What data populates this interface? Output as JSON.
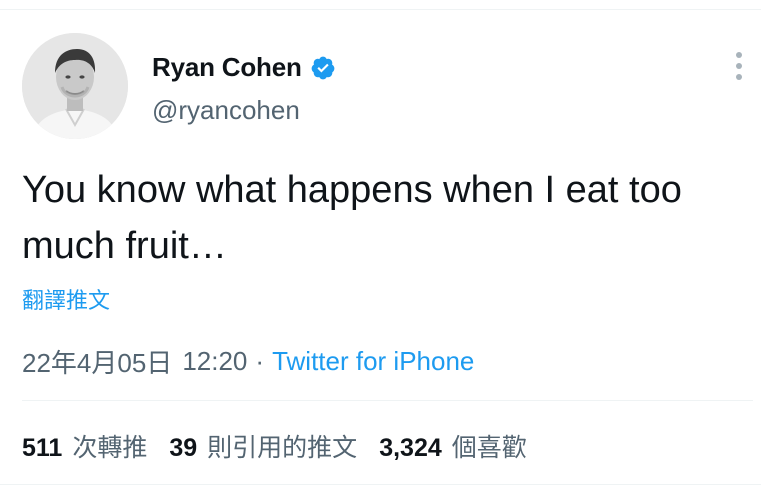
{
  "author": {
    "display_name": "Ryan Cohen",
    "handle": "@ryancohen",
    "verified": true
  },
  "tweet": {
    "text": "You know what happens when I eat too much fruit…",
    "translate_label": "翻譯推文",
    "date": "22年4月05日",
    "time": "12:20",
    "separator": "·",
    "source": "Twitter for iPhone"
  },
  "stats": {
    "retweets": {
      "count": "511",
      "label": "次轉推"
    },
    "quotes": {
      "count": "39",
      "label": "則引用的推文"
    },
    "likes": {
      "count": "3,324",
      "label": "個喜歡"
    }
  },
  "icons": {
    "verified": "verified-badge-icon",
    "more": "more-options-icon"
  },
  "colors": {
    "accent": "#1d9bf0",
    "text_primary": "#0f1419",
    "text_secondary": "#536471",
    "divider": "#eff3f4"
  }
}
